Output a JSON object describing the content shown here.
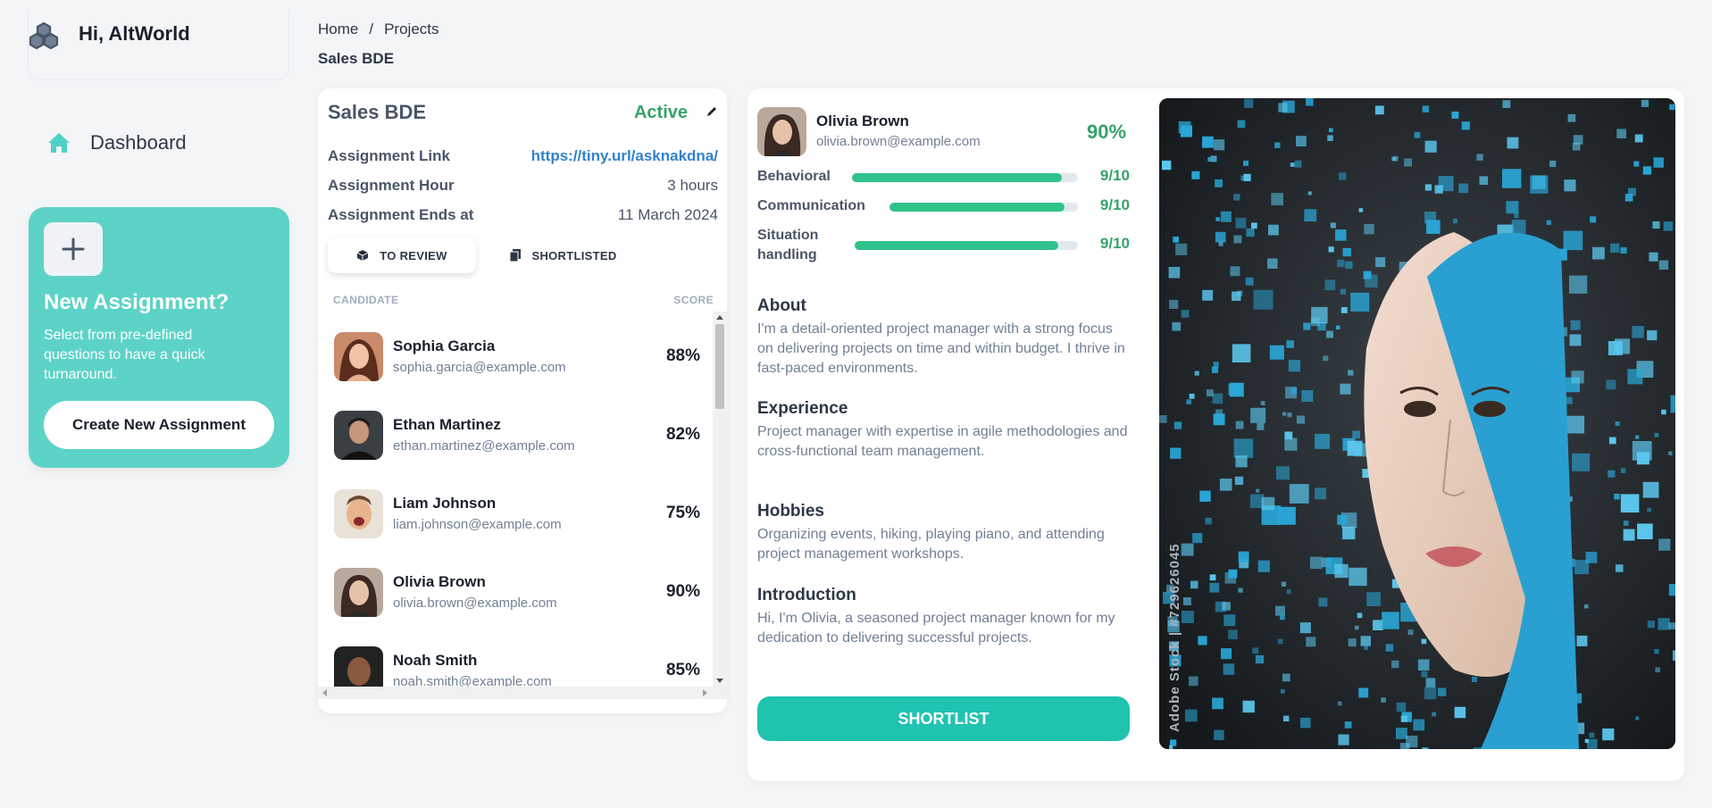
{
  "sidebar": {
    "greeting": "Hi, AltWorld",
    "nav": [
      {
        "label": "Dashboard",
        "icon": "home-icon"
      }
    ],
    "promo": {
      "title": "New Assignment?",
      "description": "Select from pre-defined questions to have a quick turnaround.",
      "button_label": "Create New Assignment"
    }
  },
  "breadcrumb": {
    "items": [
      "Home",
      "Projects"
    ],
    "separator": "/",
    "current": "Sales BDE"
  },
  "assignment": {
    "title": "Sales BDE",
    "status": "Active",
    "info": [
      {
        "key": "Assignment Link",
        "value": "https://tiny.url/asknakdna/"
      },
      {
        "key": "Assignment Hour",
        "value": "3 hours"
      },
      {
        "key": "Assignment Ends at",
        "value": "11 March 2024"
      }
    ],
    "tabs": [
      {
        "label": "TO REVIEW",
        "active": true,
        "icon": "cube-icon"
      },
      {
        "label": "SHORTLISTED",
        "active": false,
        "icon": "document-icon"
      }
    ],
    "columns": {
      "candidate": "CANDIDATE",
      "score": "SCORE"
    },
    "candidates": [
      {
        "name": "Sophia Garcia",
        "email": "sophia.garcia@example.com",
        "score": "88%"
      },
      {
        "name": "Ethan Martinez",
        "email": "ethan.martinez@example.com",
        "score": "82%"
      },
      {
        "name": "Liam Johnson",
        "email": "liam.johnson@example.com",
        "score": "75%"
      },
      {
        "name": "Olivia Brown",
        "email": "olivia.brown@example.com",
        "score": "90%"
      },
      {
        "name": "Noah Smith",
        "email": "noah.smith@example.com",
        "score": "85%"
      }
    ]
  },
  "profile": {
    "name": "Olivia Brown",
    "email": "olivia.brown@example.com",
    "score": "90%",
    "metrics": [
      {
        "label": "Behavioral",
        "value": "9/10",
        "fraction": 0.93
      },
      {
        "label": "Communication",
        "value": "9/10",
        "fraction": 0.93
      },
      {
        "label": "Situation handling",
        "value": "9/10",
        "fraction": 0.91
      }
    ],
    "sections": [
      {
        "heading": "About",
        "text": "I'm a detail-oriented project manager with a strong focus on delivering projects on time and within budget. I thrive in fast-paced environments."
      },
      {
        "heading": "Experience",
        "text": "Project manager with expertise in agile methodologies and cross-functional team management."
      },
      {
        "heading": "Hobbies",
        "text": "Organizing events, hiking, playing piano, and attending project management workshops."
      },
      {
        "heading": "Introduction",
        "text": "Hi, I'm Olivia, a seasoned project manager known for my dedication to delivering successful projects."
      }
    ],
    "action_label": "SHORTLIST",
    "image_watermark": "Adobe Stock | #729626045"
  },
  "colors": {
    "accent": "#5dd3c7",
    "button": "#20c2b0",
    "success": "#38a169",
    "link": "#3182ce",
    "bar": "#2fc28b"
  }
}
